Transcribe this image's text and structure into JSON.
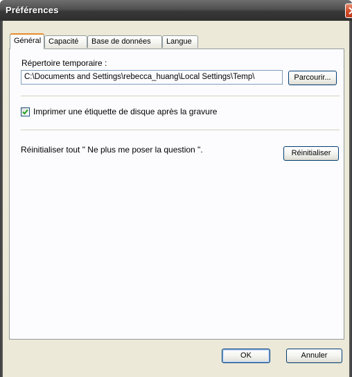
{
  "window": {
    "title": "Préférences"
  },
  "tabs": [
    {
      "label": "Général",
      "active": true
    },
    {
      "label": "Capacité",
      "active": false
    },
    {
      "label": "Base de données",
      "active": false
    },
    {
      "label": "Langue",
      "active": false
    }
  ],
  "general": {
    "temp_dir_label": "Répertoire temporaire :",
    "temp_dir_value": "C:\\Documents and Settings\\rebecca_huang\\Local Settings\\Temp\\",
    "browse_label": "Parcourir...",
    "print_label_checkbox": {
      "label": "Imprimer une étiquette de disque après la gravure",
      "checked": true
    },
    "reset_text": "Réinitialiser tout \" Ne plus me poser la question \".",
    "reset_button": "Réinitialiser"
  },
  "footer": {
    "ok_label": "OK",
    "cancel_label": "Annuler"
  },
  "colors": {
    "tab_accent": "#e68b2c",
    "close_button": "#d2502c",
    "client_background": "#ece9d8",
    "checkmark": "#21a121"
  },
  "icons": {
    "close": "close-icon",
    "check": "checkmark-icon"
  }
}
